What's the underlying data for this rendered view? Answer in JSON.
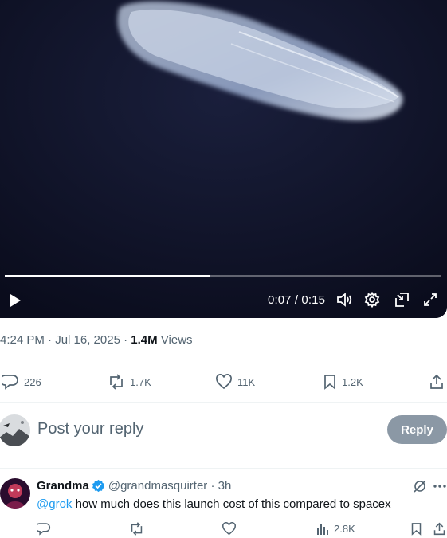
{
  "video": {
    "time_current": "0:07",
    "time_separator": " / ",
    "time_total": "0:15",
    "progress": 0.47,
    "icons": [
      "play-icon",
      "volume-icon",
      "settings-icon",
      "dock-icon",
      "fullscreen-icon"
    ]
  },
  "post": {
    "timestamp": "4:24 PM · Jul 16, 2025 · ",
    "views_count": "1.4M",
    "views_label": " Views",
    "replies": "226",
    "reposts": "1.7K",
    "likes": "11K",
    "bookmarks": "1.2K"
  },
  "composer": {
    "placeholder": "Post your reply",
    "button_label": "Reply"
  },
  "reply": {
    "author_name": "Grandma",
    "handle_time": "@grandmasquirter · 3h",
    "mention": "@grok",
    "text": " how much does this launch cost of this compared to spacex",
    "views": "2.8K"
  },
  "colors": {
    "accent": "#1d9bf0",
    "muted": "#536471",
    "video_bg": "#0d1024",
    "reply_btn": "#8b98a5"
  }
}
